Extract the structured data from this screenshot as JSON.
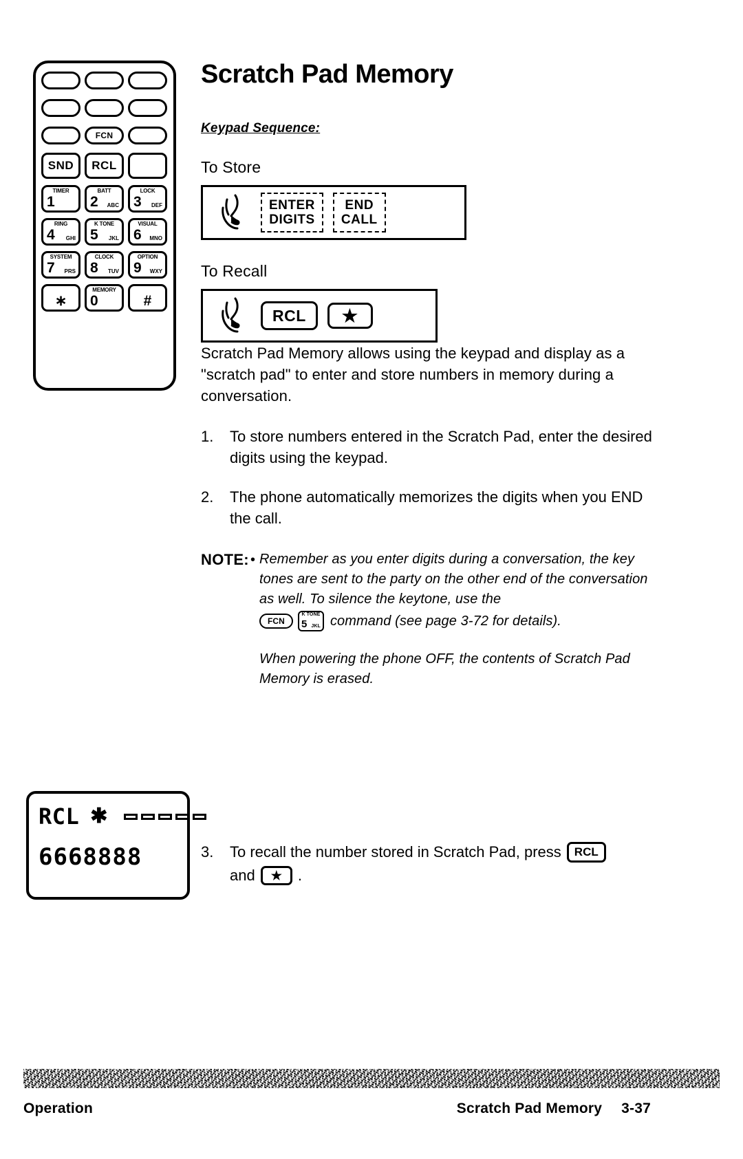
{
  "page": {
    "title": "Scratch Pad Memory",
    "keypad_sequence_label": "Keypad Sequence:",
    "store_label": "To Store",
    "recall_label": "To Recall"
  },
  "handset": {
    "soft_keys_row1": [
      "",
      "",
      ""
    ],
    "soft_keys_row2": [
      "",
      "",
      ""
    ],
    "soft_keys_row3": [
      "",
      "FCN",
      ""
    ],
    "function_keys": [
      "SND",
      "RCL",
      ""
    ],
    "number_keys": [
      {
        "func": "TIMER",
        "digit": "1",
        "letters": ""
      },
      {
        "func": "BATT",
        "digit": "2",
        "letters": "ABC"
      },
      {
        "func": "LOCK",
        "digit": "3",
        "letters": "DEF"
      },
      {
        "func": "RING",
        "digit": "4",
        "letters": "GHI"
      },
      {
        "func": "K TONE",
        "digit": "5",
        "letters": "JKL"
      },
      {
        "func": "VISUAL",
        "digit": "6",
        "letters": "MNO"
      },
      {
        "func": "SYSTEM",
        "digit": "7",
        "letters": "PRS"
      },
      {
        "func": "CLOCK",
        "digit": "8",
        "letters": "TUV"
      },
      {
        "func": "OPTION",
        "digit": "9",
        "letters": "WXY"
      },
      {
        "func": "",
        "digit": "∗",
        "letters": ""
      },
      {
        "func": "MEMORY",
        "digit": "0",
        "letters": ""
      },
      {
        "func": "",
        "digit": "#",
        "letters": ""
      }
    ]
  },
  "store_sequence": {
    "icon": "pointing-finger-icon",
    "steps": [
      {
        "line1": "ENTER",
        "line2": "DIGITS"
      },
      {
        "line1": "END",
        "line2": "CALL"
      }
    ]
  },
  "recall_sequence": {
    "icon": "pointing-finger-icon",
    "keys": [
      "RCL",
      "★"
    ]
  },
  "intro": "Scratch Pad Memory allows using the keypad and display as a \"scratch pad\" to enter and store numbers in memory during a conversation.",
  "steps": [
    {
      "num": "1.",
      "text": "To store numbers entered in the Scratch Pad, enter the desired digits using the keypad."
    },
    {
      "num": "2.",
      "text": "The phone automatically memorizes the digits when you END the call."
    }
  ],
  "note": {
    "label": "NOTE:",
    "bullet": "•",
    "para1_before": "Remember as you enter digits during a conversation, the key tones are sent to the party on the other end of the conversation as well.  To silence the keytone, use the",
    "inline_fcn": "FCN",
    "inline_key": {
      "func": "K TONE",
      "digit": "5",
      "letters": "JKL"
    },
    "para1_after": "command (see page 3-72 for details).",
    "para2": "When powering the phone OFF, the contents of Scratch Pad Memory is erased."
  },
  "lcd": {
    "mode": "RCL",
    "asterisk": "✱",
    "segment_count": 5,
    "number": "6668888"
  },
  "step3": {
    "num": "3.",
    "text_before": "To recall the number stored in Scratch Pad, press",
    "key1": "RCL",
    "text_mid": "and",
    "key2": "★",
    "text_after": "."
  },
  "footer": {
    "left": "Operation",
    "section": "Scratch Pad Memory",
    "page_number": "3-37"
  }
}
